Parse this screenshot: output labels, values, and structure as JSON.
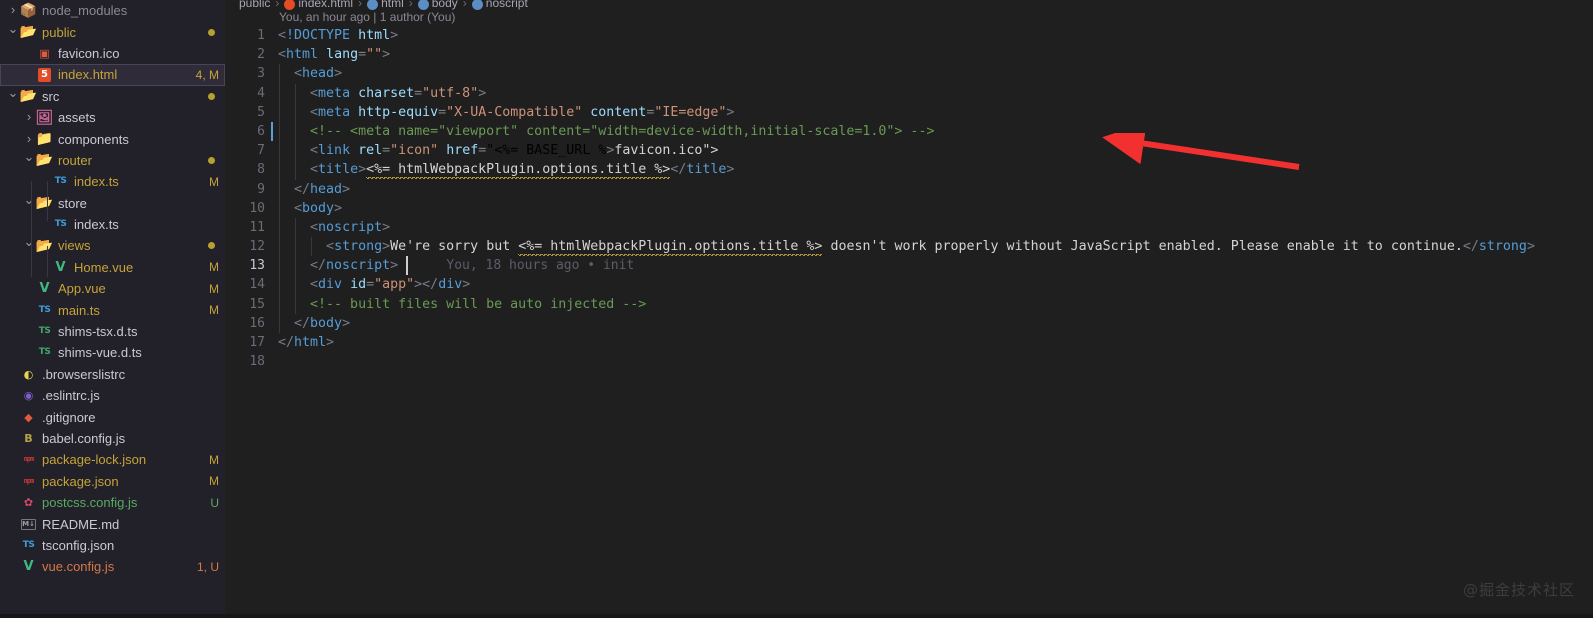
{
  "window": {
    "watermark": "@掘金技术社区",
    "colors": {
      "editor_bg": "#1f1f1f",
      "sidebar_bg": "#222028",
      "selection_bg": "#2f2b38",
      "modified_badge": "#c5a43a",
      "untracked_badge": "#5aab62",
      "arrow_accent": "#f23030"
    }
  },
  "sidebar": {
    "items": [
      {
        "label": "node_modules",
        "indent": 0,
        "twisty": "right",
        "icon": "folder-node-modules-icon",
        "icon_glyph": "📦",
        "icon_color": "#8bc34a",
        "text_color": "#8c8894",
        "badge": "",
        "badge_color": "",
        "dot": false,
        "selected": false
      },
      {
        "label": "public",
        "indent": 0,
        "twisty": "down",
        "icon": "folder-public-icon",
        "icon_glyph": "📂",
        "icon_color": "#5bbf72",
        "text_color": "#c5a43a",
        "badge": "",
        "badge_color": "",
        "dot": true,
        "selected": false
      },
      {
        "label": "favicon.ico",
        "indent": 1,
        "twisty": "none",
        "icon": "favicon-image-icon",
        "icon_glyph": "▣",
        "icon_color": "#e05a3c",
        "text_color": "#ccc9d6",
        "badge": "",
        "badge_color": "",
        "dot": false,
        "selected": false
      },
      {
        "label": "index.html",
        "indent": 1,
        "twisty": "none",
        "icon": "html5-file-icon",
        "icon_glyph": "5",
        "icon_color": "#e34c26",
        "text_color": "#c5a43a",
        "badge": "4, M",
        "badge_color": "#c5a43a",
        "dot": false,
        "selected": true
      },
      {
        "label": "src",
        "indent": 0,
        "twisty": "down",
        "icon": "folder-src-icon",
        "icon_glyph": "📂",
        "icon_color": "#5bbf72",
        "text_color": "#ccc9d6",
        "badge": "",
        "badge_color": "",
        "dot": true,
        "selected": false
      },
      {
        "label": "assets",
        "indent": 1,
        "twisty": "right",
        "icon": "folder-assets-icon",
        "icon_glyph": "🖼",
        "icon_color": "#cc6699",
        "text_color": "#ccc9d6",
        "badge": "",
        "badge_color": "",
        "dot": false,
        "selected": false
      },
      {
        "label": "components",
        "indent": 1,
        "twisty": "right",
        "icon": "folder-components-icon",
        "icon_glyph": "📁",
        "icon_color": "#e8b339",
        "text_color": "#ccc9d6",
        "badge": "",
        "badge_color": "",
        "dot": false,
        "selected": false
      },
      {
        "label": "router",
        "indent": 1,
        "twisty": "down",
        "icon": "folder-router-icon",
        "icon_glyph": "📂",
        "icon_color": "#e8c07a",
        "text_color": "#c5a43a",
        "badge": "",
        "badge_color": "",
        "dot": true,
        "selected": false
      },
      {
        "label": "index.ts",
        "indent": 2,
        "twisty": "none",
        "icon": "typescript-file-icon",
        "icon_glyph": "TS",
        "icon_color": "#3b9ddd",
        "text_color": "#c5a43a",
        "badge": "M",
        "badge_color": "#c5a43a",
        "dot": false,
        "selected": false
      },
      {
        "label": "store",
        "indent": 1,
        "twisty": "down",
        "icon": "folder-store-icon",
        "icon_glyph": "📂",
        "icon_color": "#e8c07a",
        "text_color": "#ccc9d6",
        "badge": "",
        "badge_color": "",
        "dot": false,
        "selected": false
      },
      {
        "label": "index.ts",
        "indent": 2,
        "twisty": "none",
        "icon": "typescript-file-icon",
        "icon_glyph": "TS",
        "icon_color": "#3b9ddd",
        "text_color": "#ccc9d6",
        "badge": "",
        "badge_color": "",
        "dot": false,
        "selected": false
      },
      {
        "label": "views",
        "indent": 1,
        "twisty": "down",
        "icon": "folder-views-icon",
        "icon_glyph": "📂",
        "icon_color": "#e05a3c",
        "text_color": "#c5a43a",
        "badge": "",
        "badge_color": "",
        "dot": true,
        "selected": false
      },
      {
        "label": "Home.vue",
        "indent": 2,
        "twisty": "none",
        "icon": "vue-file-icon",
        "icon_glyph": "V",
        "icon_color": "#41b883",
        "text_color": "#c5a43a",
        "badge": "M",
        "badge_color": "#c5a43a",
        "dot": false,
        "selected": false
      },
      {
        "label": "App.vue",
        "indent": 1,
        "twisty": "none",
        "icon": "vue-file-icon",
        "icon_glyph": "V",
        "icon_color": "#41b883",
        "text_color": "#c5a43a",
        "badge": "M",
        "badge_color": "#c5a43a",
        "dot": false,
        "selected": false
      },
      {
        "label": "main.ts",
        "indent": 1,
        "twisty": "none",
        "icon": "typescript-file-icon",
        "icon_glyph": "TS",
        "icon_color": "#3b9ddd",
        "text_color": "#c5a43a",
        "badge": "M",
        "badge_color": "#c5a43a",
        "dot": false,
        "selected": false
      },
      {
        "label": "shims-tsx.d.ts",
        "indent": 1,
        "twisty": "none",
        "icon": "typescript-def-file-icon",
        "icon_glyph": "TS",
        "icon_color": "#3fa96b",
        "text_color": "#ccc9d6",
        "badge": "",
        "badge_color": "",
        "dot": false,
        "selected": false
      },
      {
        "label": "shims-vue.d.ts",
        "indent": 1,
        "twisty": "none",
        "icon": "typescript-def-file-icon",
        "icon_glyph": "TS",
        "icon_color": "#3fa96b",
        "text_color": "#ccc9d6",
        "badge": "",
        "badge_color": "",
        "dot": false,
        "selected": false
      },
      {
        "label": ".browserslistrc",
        "indent": 0,
        "twisty": "none",
        "icon": "browserslist-file-icon",
        "icon_glyph": "◐",
        "icon_color": "#e8d44d",
        "text_color": "#ccc9d6",
        "badge": "",
        "badge_color": "",
        "dot": false,
        "selected": false
      },
      {
        "label": ".eslintrc.js",
        "indent": 0,
        "twisty": "none",
        "icon": "eslint-file-icon",
        "icon_glyph": "◉",
        "icon_color": "#7b60cf",
        "text_color": "#ccc9d6",
        "badge": "",
        "badge_color": "",
        "dot": false,
        "selected": false
      },
      {
        "label": ".gitignore",
        "indent": 0,
        "twisty": "none",
        "icon": "git-file-icon",
        "icon_glyph": "◆",
        "icon_color": "#e05a3c",
        "text_color": "#ccc9d6",
        "badge": "",
        "badge_color": "",
        "dot": false,
        "selected": false
      },
      {
        "label": "babel.config.js",
        "indent": 0,
        "twisty": "none",
        "icon": "babel-file-icon",
        "icon_glyph": "B",
        "icon_color": "#b8a243",
        "text_color": "#ccc9d6",
        "badge": "",
        "badge_color": "",
        "dot": false,
        "selected": false
      },
      {
        "label": "package-lock.json",
        "indent": 0,
        "twisty": "none",
        "icon": "npm-file-icon",
        "icon_glyph": "npm",
        "icon_color": "#cb3837",
        "text_color": "#c5a43a",
        "badge": "M",
        "badge_color": "#c5a43a",
        "dot": false,
        "selected": false
      },
      {
        "label": "package.json",
        "indent": 0,
        "twisty": "none",
        "icon": "npm-file-icon",
        "icon_glyph": "npm",
        "icon_color": "#cb3837",
        "text_color": "#c5a43a",
        "badge": "M",
        "badge_color": "#c5a43a",
        "dot": false,
        "selected": false
      },
      {
        "label": "postcss.config.js",
        "indent": 0,
        "twisty": "none",
        "icon": "postcss-file-icon",
        "icon_glyph": "✿",
        "icon_color": "#d4486b",
        "text_color": "#5aab62",
        "badge": "U",
        "badge_color": "#5aab62",
        "dot": false,
        "selected": false
      },
      {
        "label": "README.md",
        "indent": 0,
        "twisty": "none",
        "icon": "markdown-file-icon",
        "icon_glyph": "M↓",
        "icon_color": "#9aa0a6",
        "text_color": "#ccc9d6",
        "badge": "",
        "badge_color": "",
        "dot": false,
        "selected": false
      },
      {
        "label": "tsconfig.json",
        "indent": 0,
        "twisty": "none",
        "icon": "typescript-config-icon",
        "icon_glyph": "TS",
        "icon_color": "#3b9ddd",
        "text_color": "#ccc9d6",
        "badge": "",
        "badge_color": "",
        "dot": false,
        "selected": false
      },
      {
        "label": "vue.config.js",
        "indent": 0,
        "twisty": "none",
        "icon": "vue-config-icon",
        "icon_glyph": "V",
        "icon_color": "#41b883",
        "text_color": "#d4794a",
        "badge": "1, U",
        "badge_color": "#d4794a",
        "dot": false,
        "selected": false
      }
    ]
  },
  "editor": {
    "breadcrumb": [
      {
        "label": "public",
        "icon": "folder-icon",
        "color": "#a9a5b3"
      },
      {
        "label": "index.html",
        "icon": "html5-icon",
        "color": "#e34c26"
      },
      {
        "label": "html",
        "icon": "tag-icon",
        "color": "#5a8ec4"
      },
      {
        "label": "body",
        "icon": "tag-icon",
        "color": "#5a8ec4"
      },
      {
        "label": "noscript",
        "icon": "tag-icon",
        "color": "#5a8ec4"
      }
    ],
    "blame_header": "You, an hour ago | 1 author (You)",
    "inline_blame": {
      "line": 13,
      "text": "You, 18 hours ago • init"
    },
    "cursor": {
      "line": 13,
      "column": 16
    },
    "line_numbers": [
      1,
      2,
      3,
      4,
      5,
      6,
      7,
      8,
      9,
      10,
      11,
      12,
      13,
      14,
      15,
      16,
      17,
      18
    ],
    "lines": [
      {
        "n": 1,
        "text": "<!DOCTYPE html>"
      },
      {
        "n": 2,
        "text": "<html lang=\"\">"
      },
      {
        "n": 3,
        "text": "  <head>"
      },
      {
        "n": 4,
        "text": "    <meta charset=\"utf-8\">"
      },
      {
        "n": 5,
        "text": "    <meta http-equiv=\"X-UA-Compatible\" content=\"IE=edge\">"
      },
      {
        "n": 6,
        "text": "    <!-- <meta name=\"viewport\" content=\"width=device-width,initial-scale=1.0\"> -->"
      },
      {
        "n": 7,
        "text": "    <link rel=\"icon\" href=\"<%= BASE_URL %>favicon.ico\">"
      },
      {
        "n": 8,
        "text": "    <title><%= htmlWebpackPlugin.options.title %></title>"
      },
      {
        "n": 9,
        "text": "  </head>"
      },
      {
        "n": 10,
        "text": "  <body>"
      },
      {
        "n": 11,
        "text": "    <noscript>"
      },
      {
        "n": 12,
        "text": "      <strong>We're sorry but <%= htmlWebpackPlugin.options.title %> doesn't work properly without JavaScript enabled. Please enable it to continue.</strong>"
      },
      {
        "n": 13,
        "text": "    </noscript>"
      },
      {
        "n": 14,
        "text": "    <div id=\"app\"></div>"
      },
      {
        "n": 15,
        "text": "    <!-- built files will be auto injected -->"
      },
      {
        "n": 16,
        "text": "  </body>"
      },
      {
        "n": 17,
        "text": "</html>"
      },
      {
        "n": 18,
        "text": ""
      }
    ]
  }
}
